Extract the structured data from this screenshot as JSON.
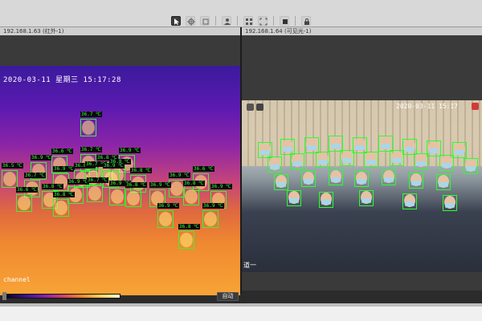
{
  "toolbar": {
    "tools": [
      "select-icon",
      "crosshair-icon",
      "square-icon",
      "person-icon",
      "grid-icon",
      "fullscreen-icon",
      "stop-icon",
      "lock-icon"
    ]
  },
  "panels": {
    "left": {
      "header": "192.168.1.63 (红外-1)",
      "timestamp": "2020-03-11  星期三  15:17:28",
      "channel": "channel"
    },
    "right": {
      "header": "192.168.1.64 (可见光-1)",
      "timestamp": "2020-03-11  15:17",
      "channel": "道一"
    }
  },
  "thermal_labels": [
    "36.7 ℃",
    "36.5 ℃",
    "36.9 ℃",
    "36.6 ℃",
    "36.7 ℃",
    "36.8 ℃",
    "36.9 ℃",
    "36.8 ℃",
    "36.7 ℃",
    "36.9 ℃",
    "36.8 ℃",
    "36.7 ℃",
    "36.9 ℃",
    "36.8 ℃",
    "36.9 ℃",
    "36.6 ℃",
    "36.8 ℃",
    "36.9 ℃",
    "36.7 ℃",
    "36.9 ℃",
    "36.8 ℃",
    "36.9 ℃",
    "36.8 ℃",
    "36.9 ℃",
    "36.6 ℃",
    "36.8 ℃",
    "36.9 ℃",
    "36.9 ℃",
    "36.8 ℃"
  ],
  "palette_label": "",
  "auto_button": "自动",
  "colors": {
    "detection": "#2cff2c",
    "label_text": "#3cff3c",
    "label_bg": "#0a0a0a"
  }
}
